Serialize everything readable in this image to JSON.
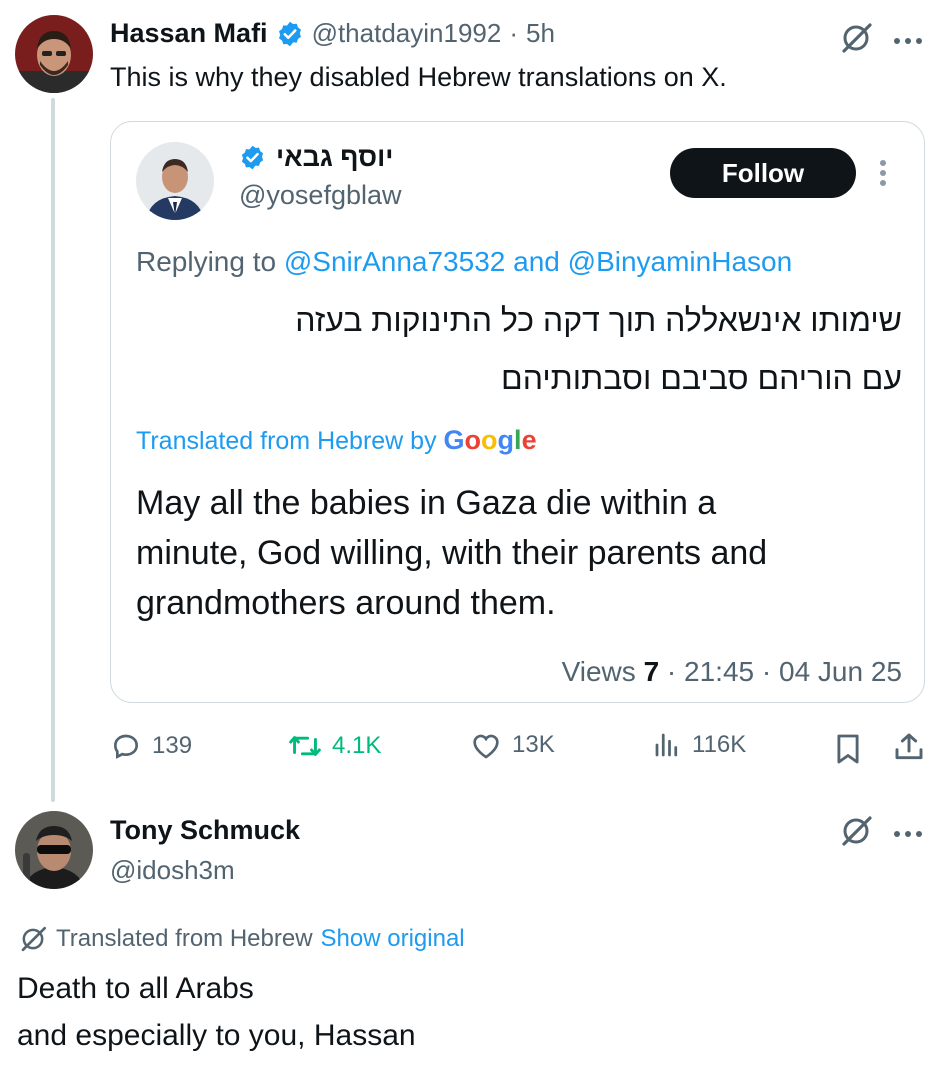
{
  "tweet1": {
    "author_name": "Hassan Mafi",
    "handle": "@thatdayin1992",
    "separator": "·",
    "time": "5h",
    "text": "This is why they disabled Hebrew translations on X.",
    "quoted": {
      "author_name": "יוסף גבאי",
      "handle": "@yosefgblaw",
      "follow_label": "Follow",
      "replying_prefix": "Replying to",
      "replying_user1": "@SnirAnna73532",
      "replying_and": "and",
      "replying_user2": "@BinyaminHason",
      "hebrew_line1": "שימותו אינשאללה תוך דקה כל התינוקות בעזה",
      "hebrew_line2": "עם הוריהם סביבם וסבתותיהם",
      "translated_label": "Translated from Hebrew by",
      "google_letters": [
        "G",
        "o",
        "o",
        "g",
        "l",
        "e"
      ],
      "google_colors": [
        "#4285F4",
        "#EA4335",
        "#FBBC05",
        "#4285F4",
        "#34A853",
        "#EA4335"
      ],
      "translation_line1": "May all the babies in Gaza die within a",
      "translation_line2": "minute, God willing, with their parents and",
      "translation_line3": "grandmothers around them.",
      "views_label": "Views",
      "views_count": "7",
      "sep1": "·",
      "time": "21:45",
      "sep2": "·",
      "date": "04 Jun 25"
    },
    "actions": {
      "replies": "139",
      "reposts": "4.1K",
      "likes": "13K",
      "views": "116K"
    }
  },
  "tweet2": {
    "author_name": "Tony Schmuck",
    "handle": "@idosh3m",
    "translated_label": "Translated from Hebrew",
    "show_original": "Show original",
    "text_line1": "Death to all Arabs",
    "text_line2": "and especially to you, Hassan"
  },
  "colors": {
    "accent": "#1d9bf0",
    "repost_green": "#00ba7c",
    "verified_blue": "#1d9bf0",
    "muted": "#536471",
    "border": "#cfd9de"
  },
  "icons": {
    "verified": "verified-badge-icon",
    "grok": "grok-icon",
    "more": "more-icon",
    "reply": "reply-icon",
    "repost": "repost-icon",
    "like": "like-icon",
    "views": "views-icon",
    "bookmark": "bookmark-icon",
    "share": "share-icon"
  }
}
